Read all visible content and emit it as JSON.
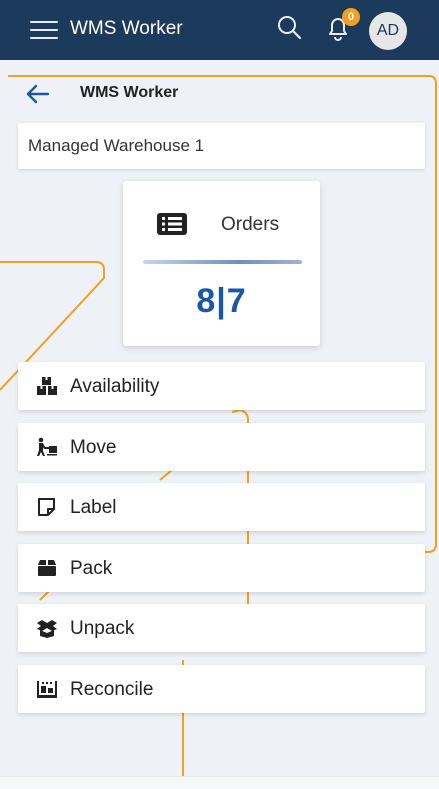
{
  "header": {
    "app_title": "WMS Worker",
    "notification_count": "0",
    "avatar_initials": "AD",
    "background_color": "#1b3a5c",
    "badge_color": "#f0a01e"
  },
  "page": {
    "title": "WMS Worker",
    "back_icon": "arrow-left-icon"
  },
  "warehouse": {
    "name": "Managed Warehouse 1"
  },
  "orders_tile": {
    "label": "Orders",
    "count": "8|7",
    "icon": "list-icon",
    "count_color": "#1c57a6"
  },
  "actions": [
    {
      "label": "Availability",
      "icon": "boxes-icon"
    },
    {
      "label": "Move",
      "icon": "person-carry-icon"
    },
    {
      "label": "Label",
      "icon": "sticky-note-icon"
    },
    {
      "label": "Pack",
      "icon": "box-icon"
    },
    {
      "label": "Unpack",
      "icon": "open-box-icon"
    },
    {
      "label": "Reconcile",
      "icon": "pallet-icon"
    }
  ],
  "decoration": {
    "line_color": "#f0a01e"
  }
}
